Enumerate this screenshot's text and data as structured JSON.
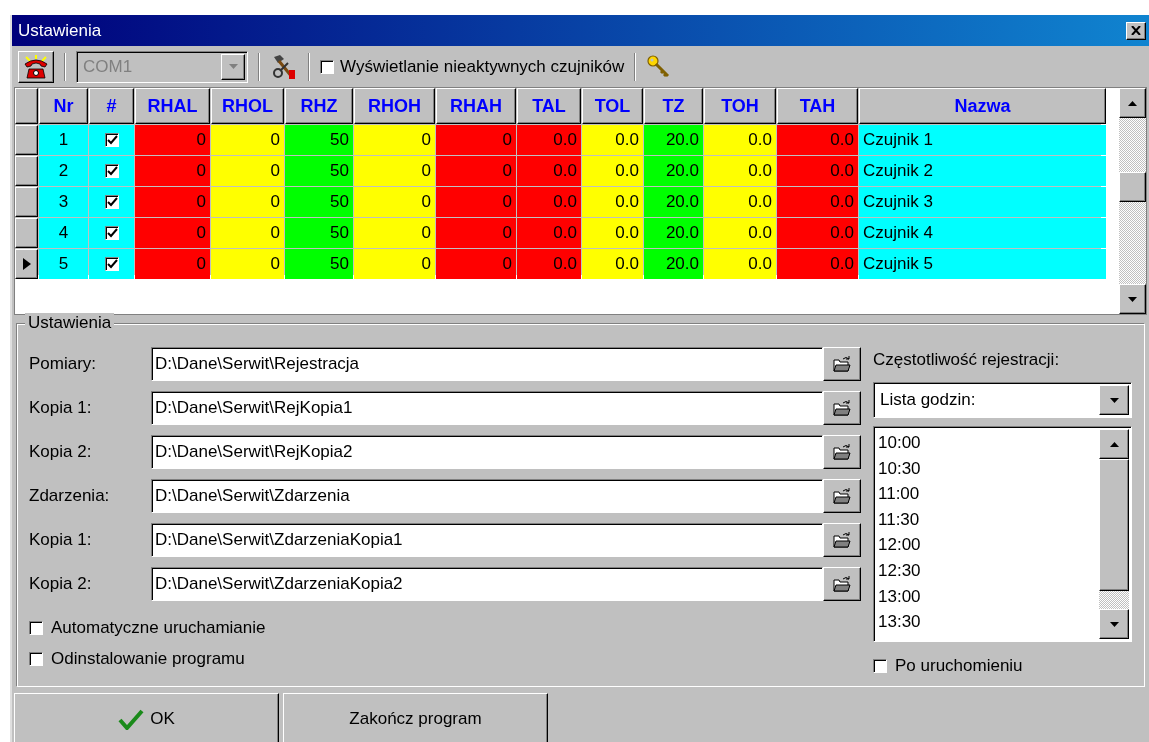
{
  "window": {
    "title": "Ustawienia"
  },
  "toolbar": {
    "port": {
      "value": "COM1",
      "disabled": true
    },
    "show_inactive": {
      "label": "Wyświetlanie nieaktywnych czujników",
      "checked": false
    }
  },
  "table": {
    "columns": [
      {
        "label": "Nr",
        "color": "#00ffff"
      },
      {
        "label": "#",
        "color": "#00ffff"
      },
      {
        "label": "RHAL",
        "color": "#ff0000"
      },
      {
        "label": "RHOL",
        "color": "#ffff00"
      },
      {
        "label": "RHZ",
        "color": "#00ff00"
      },
      {
        "label": "RHOH",
        "color": "#ffff00"
      },
      {
        "label": "RHAH",
        "color": "#ff0000"
      },
      {
        "label": "TAL",
        "color": "#ff0000"
      },
      {
        "label": "TOL",
        "color": "#ffff00"
      },
      {
        "label": "TZ",
        "color": "#00ff00"
      },
      {
        "label": "TOH",
        "color": "#ffff00"
      },
      {
        "label": "TAH",
        "color": "#ff0000"
      },
      {
        "label": "Nazwa",
        "color": "#00ffff"
      }
    ],
    "rows": [
      {
        "current": false,
        "nr": "1",
        "checked": true,
        "values": [
          "0",
          "0",
          "50",
          "0",
          "0",
          "0.0",
          "0.0",
          "20.0",
          "0.0",
          "0.0"
        ],
        "name": "Czujnik 1"
      },
      {
        "current": false,
        "nr": "2",
        "checked": true,
        "values": [
          "0",
          "0",
          "50",
          "0",
          "0",
          "0.0",
          "0.0",
          "20.0",
          "0.0",
          "0.0"
        ],
        "name": "Czujnik 2"
      },
      {
        "current": false,
        "nr": "3",
        "checked": true,
        "values": [
          "0",
          "0",
          "50",
          "0",
          "0",
          "0.0",
          "0.0",
          "20.0",
          "0.0",
          "0.0"
        ],
        "name": "Czujnik 3"
      },
      {
        "current": false,
        "nr": "4",
        "checked": true,
        "values": [
          "0",
          "0",
          "50",
          "0",
          "0",
          "0.0",
          "0.0",
          "20.0",
          "0.0",
          "0.0"
        ],
        "name": "Czujnik 4"
      },
      {
        "current": true,
        "nr": "5",
        "checked": true,
        "values": [
          "0",
          "0",
          "50",
          "0",
          "0",
          "0.0",
          "0.0",
          "20.0",
          "0.0",
          "0.0"
        ],
        "name": "Czujnik 5"
      }
    ]
  },
  "settings": {
    "title": "Ustawienia",
    "paths": [
      {
        "label": "Pomiary:",
        "value": "D:\\Dane\\Serwit\\Rejestracja"
      },
      {
        "label": "Kopia 1:",
        "value": "D:\\Dane\\Serwit\\RejKopia1"
      },
      {
        "label": "Kopia 2:",
        "value": "D:\\Dane\\Serwit\\RejKopia2"
      },
      {
        "label": "Zdarzenia:",
        "value": "D:\\Dane\\Serwit\\Zdarzenia"
      },
      {
        "label": "Kopia 1:",
        "value": "D:\\Dane\\Serwit\\ZdarzeniaKopia1"
      },
      {
        "label": "Kopia 2:",
        "value": "D:\\Dane\\Serwit\\ZdarzeniaKopia2"
      }
    ],
    "options": [
      {
        "label": "Automatyczne uruchamianie",
        "checked": false
      },
      {
        "label": "Odinstalowanie programu",
        "checked": false
      }
    ],
    "frequency": {
      "label": "Częstotliwość rejestracji:",
      "mode": "Lista godzin:",
      "hours": [
        "10:00",
        "10:30",
        "11:00",
        "11:30",
        "12:00",
        "12:30",
        "13:00",
        "13:30"
      ],
      "after_start": {
        "label": "Po uruchomieniu",
        "checked": false
      }
    }
  },
  "buttons": [
    {
      "kind": "ok",
      "label": "OK"
    },
    {
      "kind": "plain",
      "label": "Zakończ program"
    }
  ]
}
